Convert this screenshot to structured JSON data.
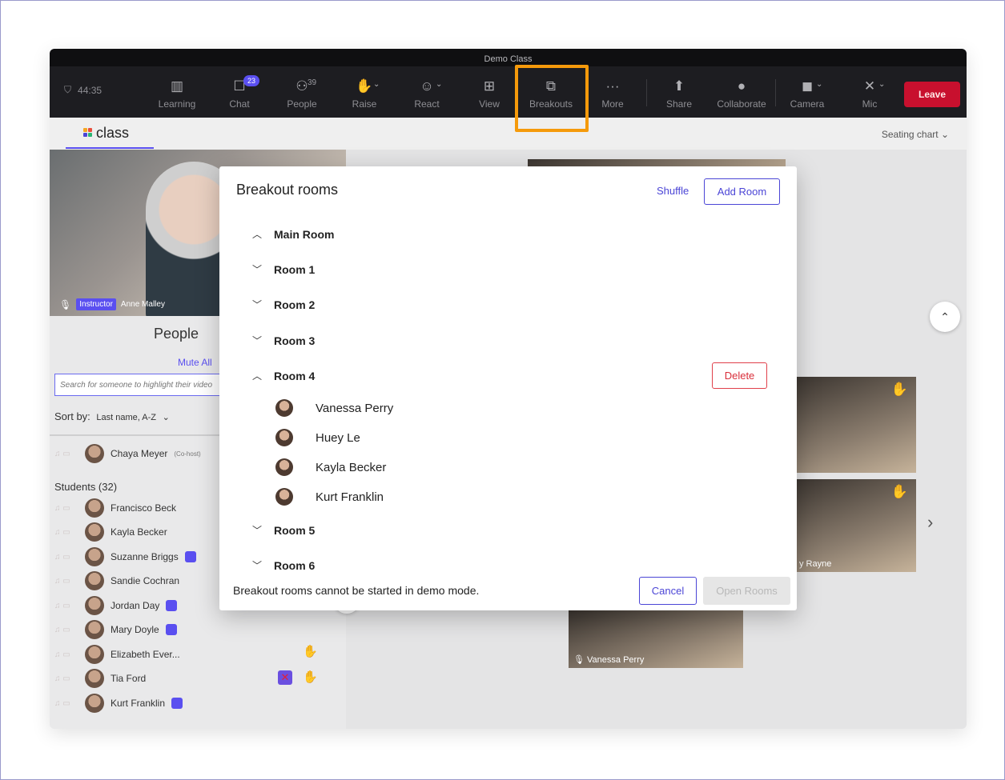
{
  "window": {
    "title": "Demo Class"
  },
  "toolbar": {
    "timer": "44:35",
    "items": [
      {
        "label": "Learning",
        "icon": "learning-icon"
      },
      {
        "label": "Chat",
        "icon": "chat-icon",
        "badge": "23"
      },
      {
        "label": "People",
        "icon": "people-icon",
        "badge": "39"
      },
      {
        "label": "Raise",
        "icon": "raise-hand-icon"
      },
      {
        "label": "React",
        "icon": "smiley-icon"
      },
      {
        "label": "View",
        "icon": "grid-view-icon"
      },
      {
        "label": "Breakouts",
        "icon": "breakouts-icon"
      },
      {
        "label": "More",
        "icon": "more-dots-icon"
      },
      {
        "label": "Share",
        "icon": "share-icon"
      },
      {
        "label": "Collaborate",
        "icon": "lightbulb-icon"
      },
      {
        "label": "Camera",
        "icon": "camera-off-icon"
      },
      {
        "label": "Mic",
        "icon": "mic-off-icon"
      }
    ],
    "leave_label": "Leave"
  },
  "subbar": {
    "logo": "class",
    "seating_label": "Seating chart"
  },
  "instructor": {
    "tag": "Instructor",
    "name": "Anne Malley"
  },
  "people_panel": {
    "title": "People",
    "mute_all": "Mute All",
    "search_placeholder": "Search for someone to highlight their video",
    "sort_label": "Sort by:",
    "sort_value": "Last name, A-Z",
    "cohost": "Chaya Meyer",
    "cohost_tag": "(Co-host)",
    "students_label": "Students (32)",
    "students": [
      "Francisco Beck",
      "Kayla Becker",
      "Suzanne Briggs",
      "Sandie Cochran",
      "Jordan Day",
      "Mary Doyle",
      "Elizabeth Ever...",
      "Tia Ford",
      "Kurt Franklin"
    ]
  },
  "gallery": {
    "names": [
      "Vanessa Perry",
      "y Rayne"
    ]
  },
  "modal": {
    "title": "Breakout rooms",
    "shuffle_label": "Shuffle",
    "add_room_label": "Add Room",
    "rooms": [
      "Main Room",
      "Room 1",
      "Room 2",
      "Room 3",
      "Room 4",
      "Room 5",
      "Room 6"
    ],
    "delete_label": "Delete",
    "room4_members": [
      "Vanessa Perry",
      "Huey Le",
      "Kayla Becker",
      "Kurt Franklin"
    ],
    "footer_text": "Breakout rooms cannot be started in demo mode.",
    "cancel_label": "Cancel",
    "open_rooms_label": "Open Rooms"
  },
  "colors": {
    "accent": "#4b45d6",
    "leave": "#c8102e",
    "highlight": "#f59a0b",
    "delete": "#d92e3a"
  }
}
